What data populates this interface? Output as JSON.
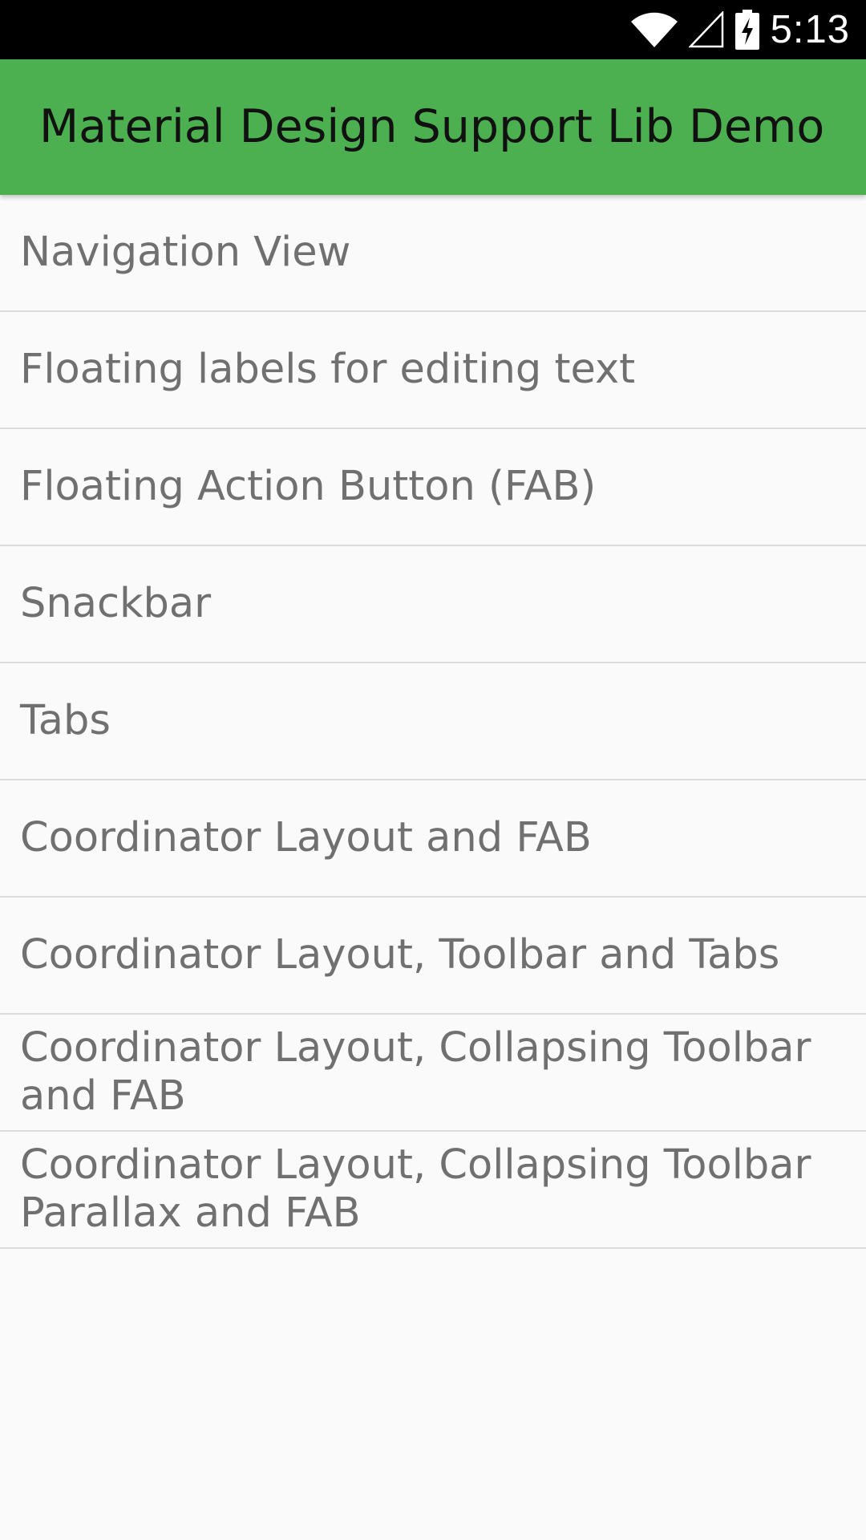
{
  "status_bar": {
    "time": "5:13",
    "icons": [
      "wifi-icon",
      "cell-signal-icon",
      "battery-charging-icon"
    ]
  },
  "app_bar": {
    "title": "Material Design Support Lib Demo",
    "color": "#4caf50"
  },
  "list": {
    "items": [
      {
        "label": "Navigation View"
      },
      {
        "label": "Floating labels for editing text"
      },
      {
        "label": "Floating Action Button (FAB)"
      },
      {
        "label": "Snackbar"
      },
      {
        "label": "Tabs"
      },
      {
        "label": "Coordinator Layout and FAB"
      },
      {
        "label": "Coordinator Layout, Toolbar and Tabs"
      },
      {
        "label": "Coordinator Layout, Collapsing Toolbar and FAB"
      },
      {
        "label": "Coordinator Layout, Collapsing Toolbar Parallax and FAB"
      }
    ]
  },
  "colors": {
    "status_bar": "#000000",
    "background": "#fafafa",
    "item_text": "#707070",
    "divider": "#dcdcdc"
  }
}
